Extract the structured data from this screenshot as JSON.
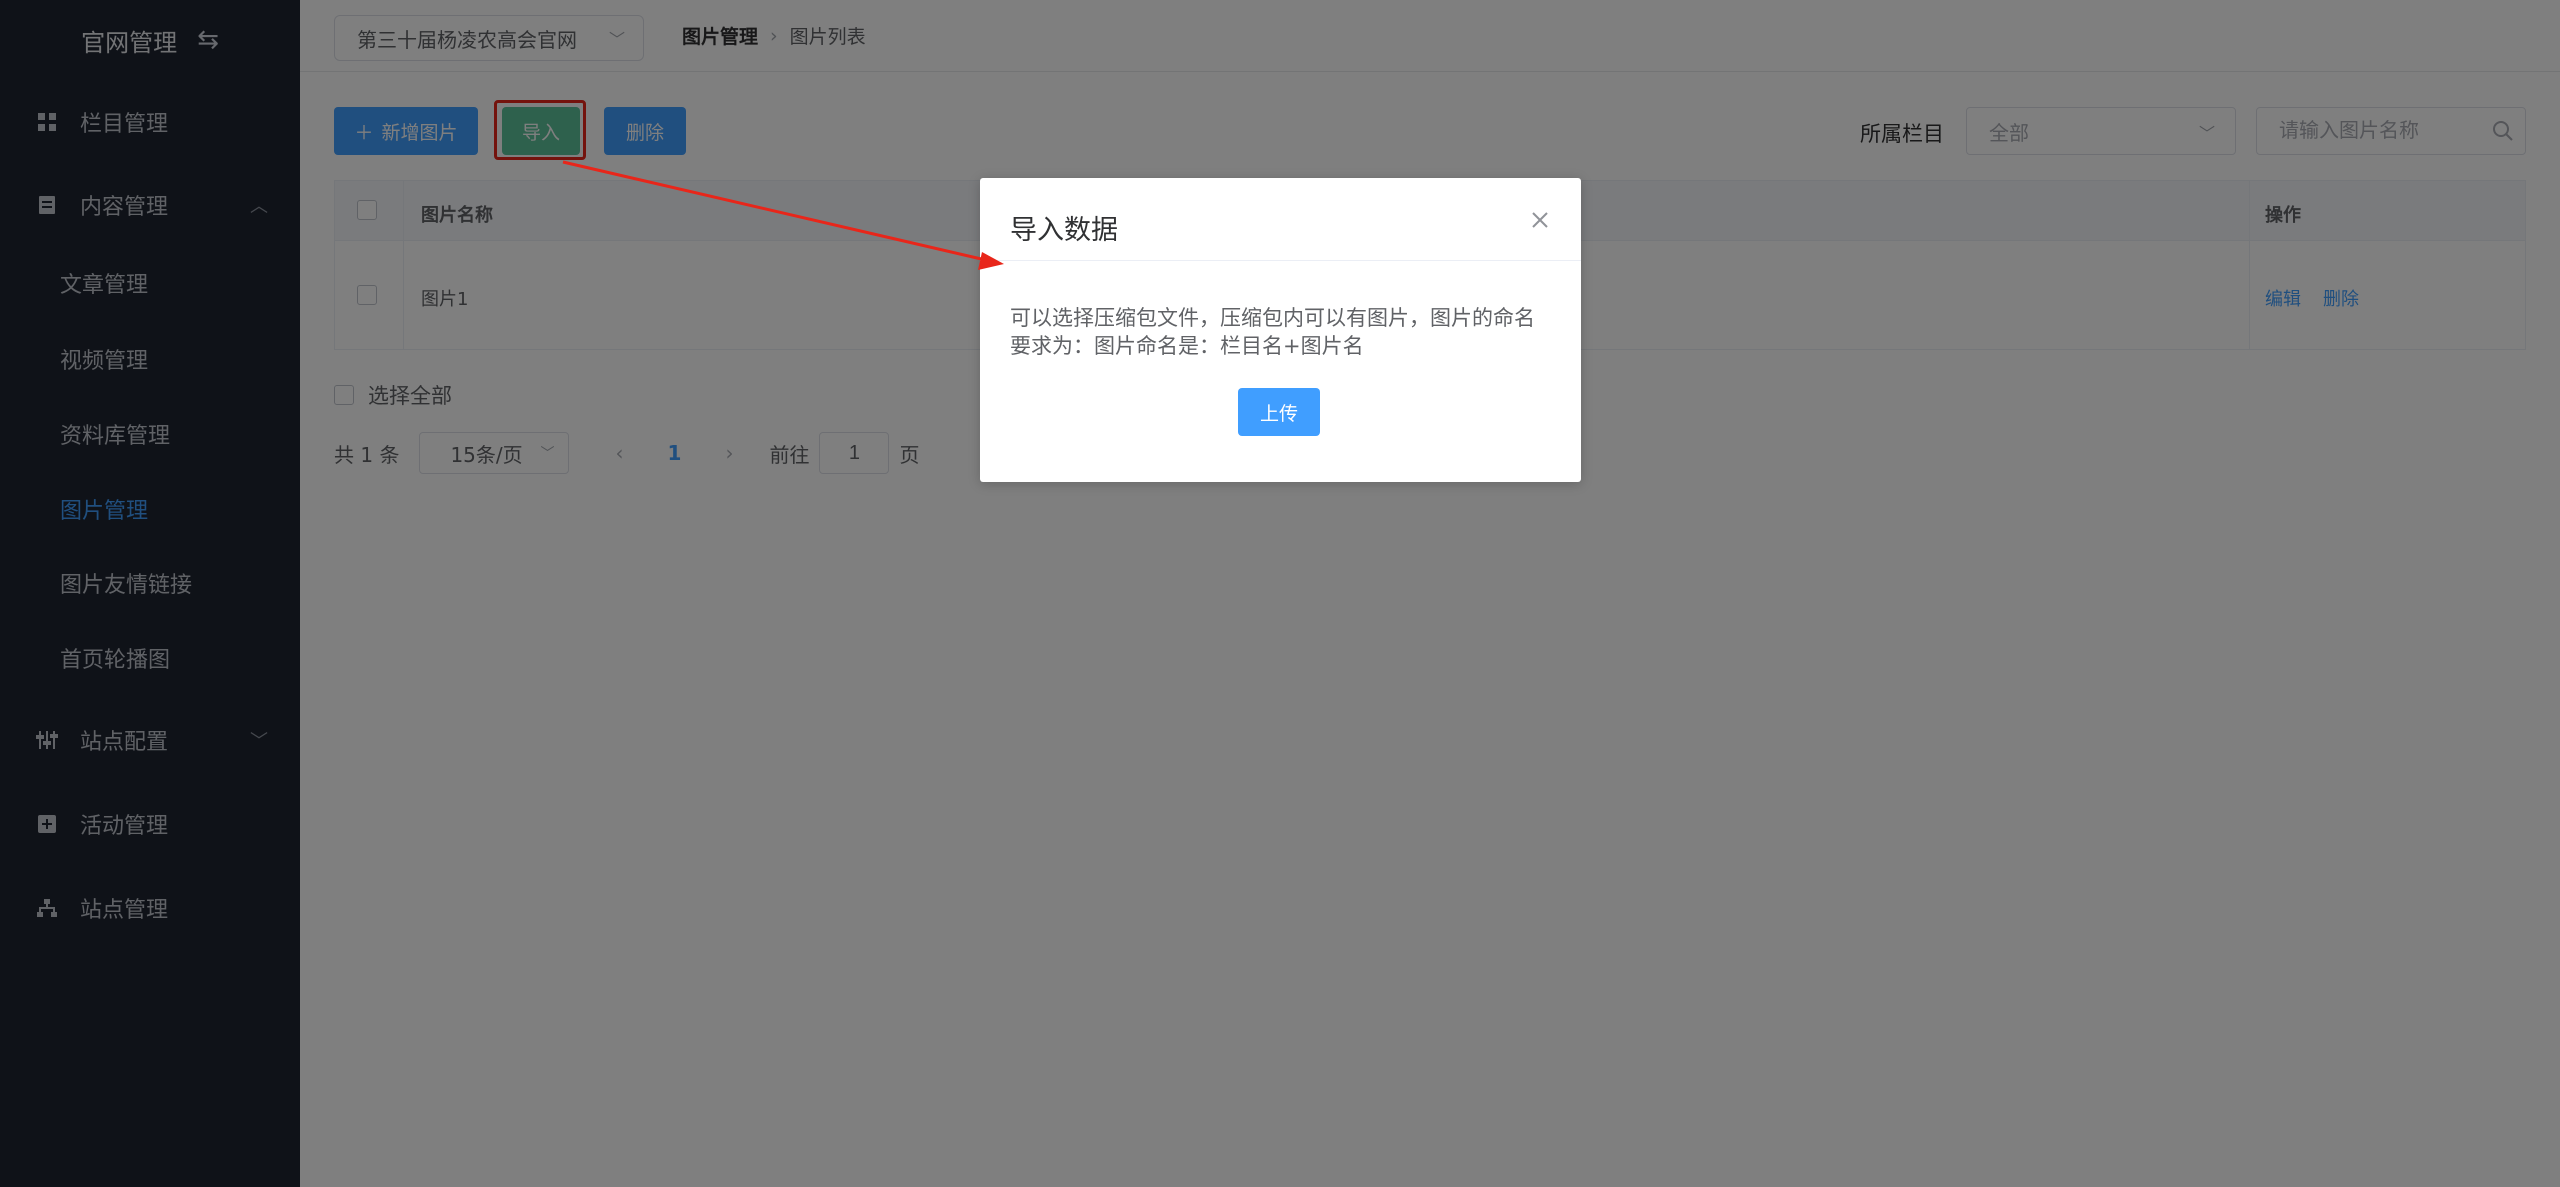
{
  "sidebar": {
    "title": "官网管理",
    "items": {
      "column": "栏目管理",
      "content": "内容管理",
      "sub_article": "文章管理",
      "sub_video": "视频管理",
      "sub_library": "资料库管理",
      "sub_image": "图片管理",
      "sub_image_links": "图片友情链接",
      "sub_carousel": "首页轮播图",
      "site_config": "站点配置",
      "activity": "活动管理",
      "site_manage": "站点管理"
    }
  },
  "topbar": {
    "site_select": "第三十届杨凌农高会官网",
    "breadcrumb": [
      "图片管理",
      "图片列表"
    ]
  },
  "toolbar": {
    "add_label": "新增图片",
    "import_label": "导入",
    "delete_label": "删除",
    "filter_label": "所属栏目",
    "category_value": "全部",
    "search_placeholder": "请输入图片名称"
  },
  "table": {
    "headers": {
      "name": "图片名称",
      "ops": "操作"
    },
    "rows": [
      {
        "name": "图片1",
        "edit": "编辑",
        "delete": "删除"
      }
    ]
  },
  "select_all": "选择全部",
  "pagination": {
    "total": "共 1 条",
    "page_size": "15条/页",
    "current_page": "1",
    "goto_prefix": "前往",
    "goto_value": "1",
    "goto_suffix": "页"
  },
  "dialog": {
    "title": "导入数据",
    "body": "可以选择压缩包文件，压缩包内可以有图片，图片的命名要求为：图片命名是：栏目名+图片名",
    "upload_label": "上传"
  },
  "colors": {
    "sidebar_bg": "#1e2431",
    "primary": "#409eff",
    "import_green": "#5cc29a",
    "annotation_red": "#e8261a"
  }
}
